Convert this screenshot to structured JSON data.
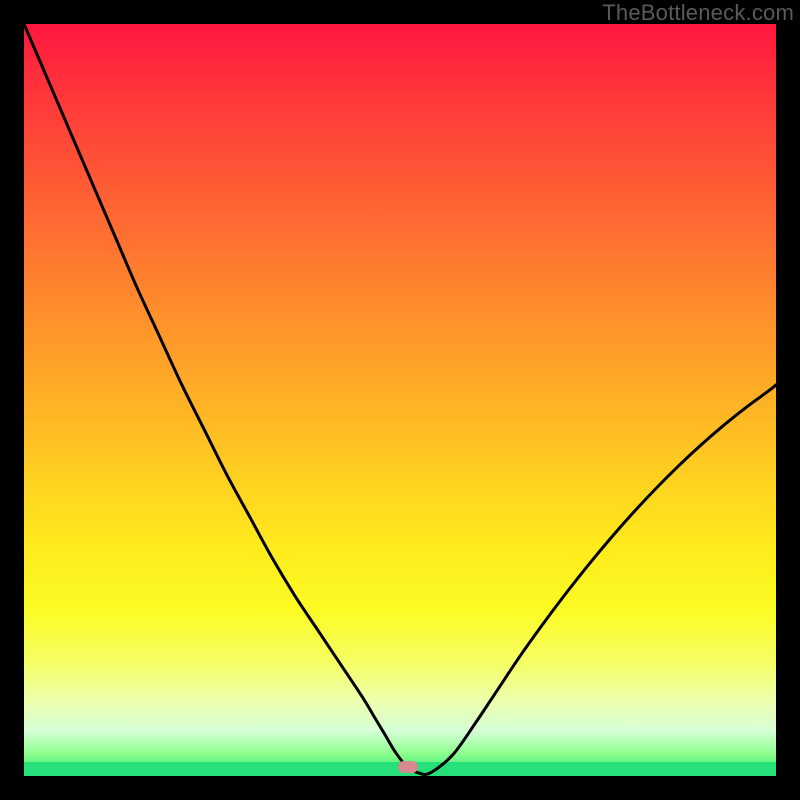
{
  "watermark": "TheBottleneck.com",
  "colors": {
    "frame": "#000000",
    "grad_top": "#ff163e",
    "grad_bot": "#28e07a",
    "curve": "#000000",
    "marker": "#d68a8f"
  },
  "chart_data": {
    "type": "line",
    "title": "",
    "xlabel": "",
    "ylabel": "",
    "xlim": [
      0,
      100
    ],
    "ylim": [
      0,
      100
    ],
    "x": [
      0,
      3,
      6,
      9,
      12,
      15,
      18,
      21,
      24,
      27,
      30,
      33,
      36,
      39,
      42,
      45,
      46.5,
      48,
      49.5,
      51,
      52.5,
      54,
      57,
      60,
      63,
      66,
      69,
      72,
      75,
      78,
      81,
      84,
      87,
      90,
      93,
      96,
      99,
      100
    ],
    "y": [
      100,
      93,
      86,
      79,
      72,
      65,
      58.5,
      52,
      46,
      40,
      34.5,
      29,
      24,
      19.5,
      15,
      10.5,
      8,
      5.5,
      3,
      1.2,
      0.4,
      0.4,
      2.8,
      7,
      11.5,
      16,
      20.2,
      24.2,
      28,
      31.6,
      35,
      38.2,
      41.2,
      44,
      46.6,
      49,
      51.2,
      52
    ],
    "marker_x": 51,
    "annotations": []
  }
}
